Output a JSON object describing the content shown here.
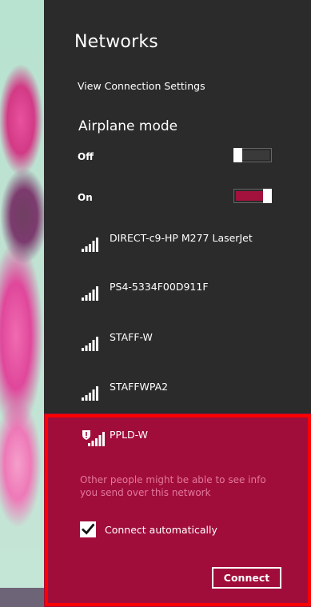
{
  "panel": {
    "title": "Networks",
    "view_settings": "View Connection Settings"
  },
  "airplane_mode": {
    "title": "Airplane mode",
    "off": {
      "label": "Off",
      "state": "off"
    },
    "on": {
      "label": "On",
      "state": "on"
    }
  },
  "networks": [
    {
      "name": "DIRECT-c9-HP M277 LaserJet",
      "icon": "wifi-signal-icon"
    },
    {
      "name": "PS4-5334F00D911F",
      "icon": "wifi-signal-icon"
    },
    {
      "name": "STAFF-W",
      "icon": "wifi-signal-icon"
    },
    {
      "name": "STAFFWPA2",
      "icon": "wifi-signal-icon"
    }
  ],
  "selected_network": {
    "name": "PPLD-W",
    "icon": "wifi-unsecured-icon",
    "warning": "Other people might be able to see info you send over this network",
    "auto_connect_label": "Connect automatically",
    "auto_connect_checked": true,
    "connect_label": "Connect"
  },
  "colors": {
    "panel_bg": "#2b2b2b",
    "accent": "#a10d3b",
    "highlight_frame": "#ff0000",
    "warning_text": "#e2789b"
  }
}
